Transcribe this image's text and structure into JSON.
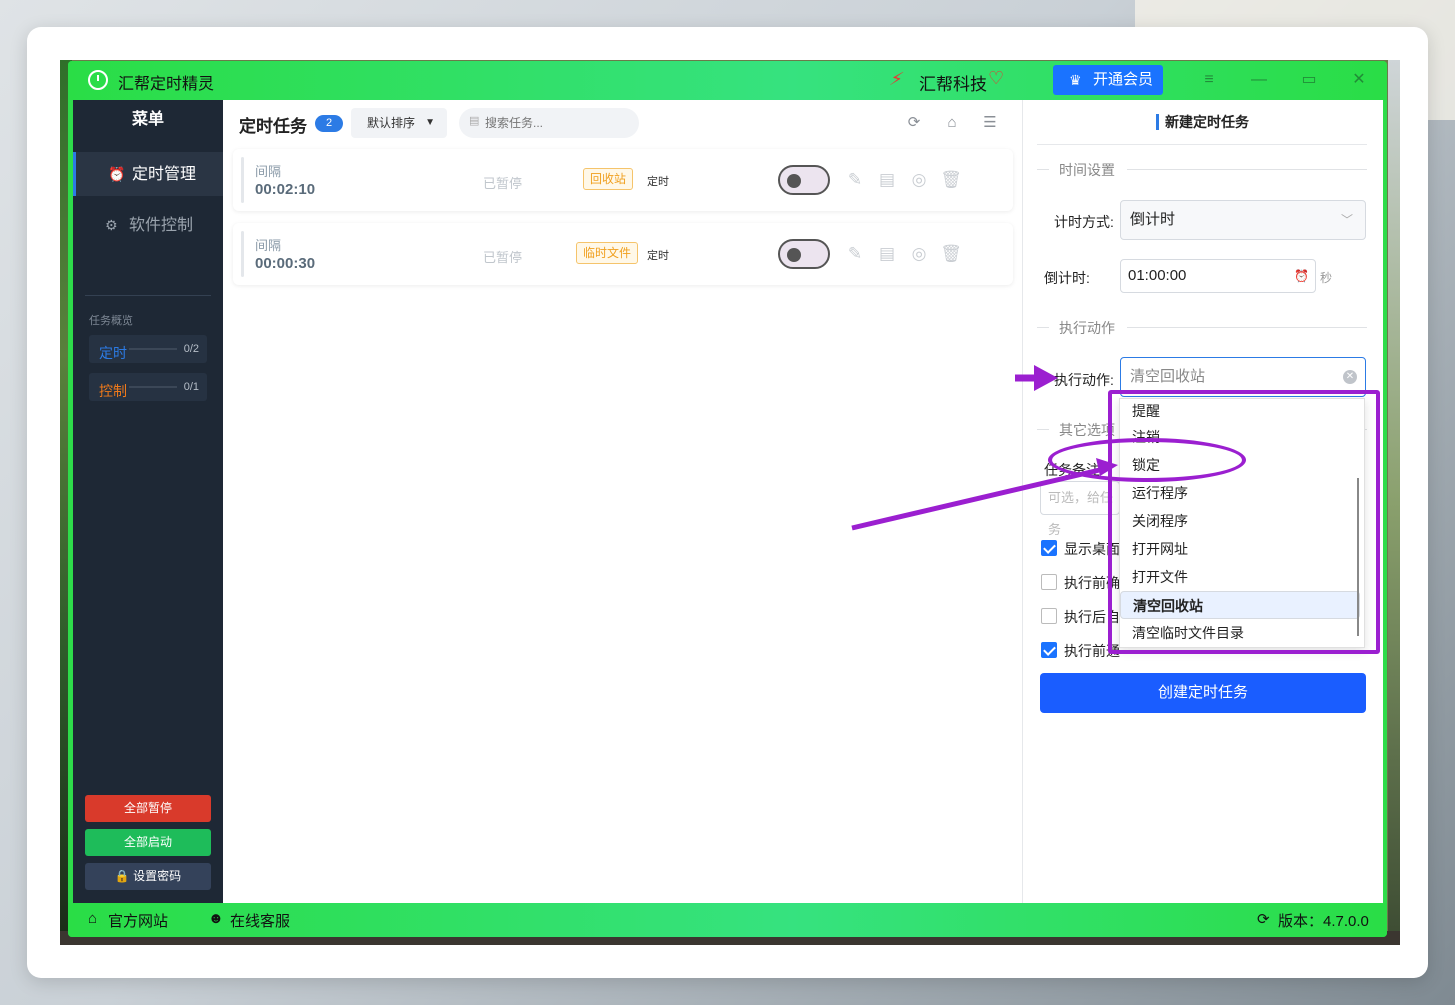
{
  "app": {
    "title": "汇帮定时精灵",
    "brand": "汇帮科技",
    "vip_button": "开通会员",
    "accent_color": "#2c7be5",
    "titlebar_color": "#2add46"
  },
  "sidebar": {
    "header": "菜单",
    "items": [
      {
        "label": "定时管理",
        "icon": "alarm-clock-icon",
        "active": true
      },
      {
        "label": "软件控制",
        "icon": "gear-icon",
        "active": false
      }
    ],
    "overview_title": "任务概览",
    "stats": [
      {
        "label": "定时",
        "value": "0/2",
        "color": "#2c7be5"
      },
      {
        "label": "控制",
        "value": "0/1",
        "color": "#f07a1a"
      }
    ],
    "buttons": {
      "pause_all": "全部暂停",
      "start_all": "全部启动",
      "set_password": "设置密码"
    }
  },
  "content": {
    "title": "定时任务",
    "count": "2",
    "sort": "默认排序",
    "search_placeholder": "搜索任务...",
    "tasks": [
      {
        "type": "间隔",
        "time": "00:02:10",
        "status": "已暂停",
        "tag": "回收站",
        "mode": "定时",
        "enabled": false
      },
      {
        "type": "间隔",
        "time": "00:00:30",
        "status": "已暂停",
        "tag": "临时文件",
        "mode": "定时",
        "enabled": false
      }
    ]
  },
  "panel": {
    "title": "新建定时任务",
    "time_section": "时间设置",
    "timing_mode_label": "计时方式:",
    "timing_mode_value": "倒计时",
    "countdown_label": "倒计时:",
    "countdown_value": "01:00:00",
    "countdown_unit": "秒",
    "action_section": "执行动作",
    "action_label": "执行动作:",
    "action_value": "清空回收站",
    "other_section": "其它选项",
    "note_label": "任务备注",
    "note_placeholder": "可选，给任务",
    "checkboxes": [
      {
        "label": "显示桌面",
        "checked": true
      },
      {
        "label": "执行前确",
        "checked": false
      },
      {
        "label": "执行后自",
        "checked": false
      },
      {
        "label": "执行前通",
        "checked": true
      }
    ],
    "create_button": "创建定时任务"
  },
  "dropdown": {
    "options": [
      "提醒",
      "注销",
      "锁定",
      "运行程序",
      "关闭程序",
      "打开网址",
      "打开文件",
      "清空回收站",
      "清空临时文件目录"
    ],
    "selected": "清空回收站"
  },
  "footer": {
    "website": "官方网站",
    "support": "在线客服",
    "version": "版本：4.7.0.0"
  },
  "annotation_color": "#9b1fd0"
}
